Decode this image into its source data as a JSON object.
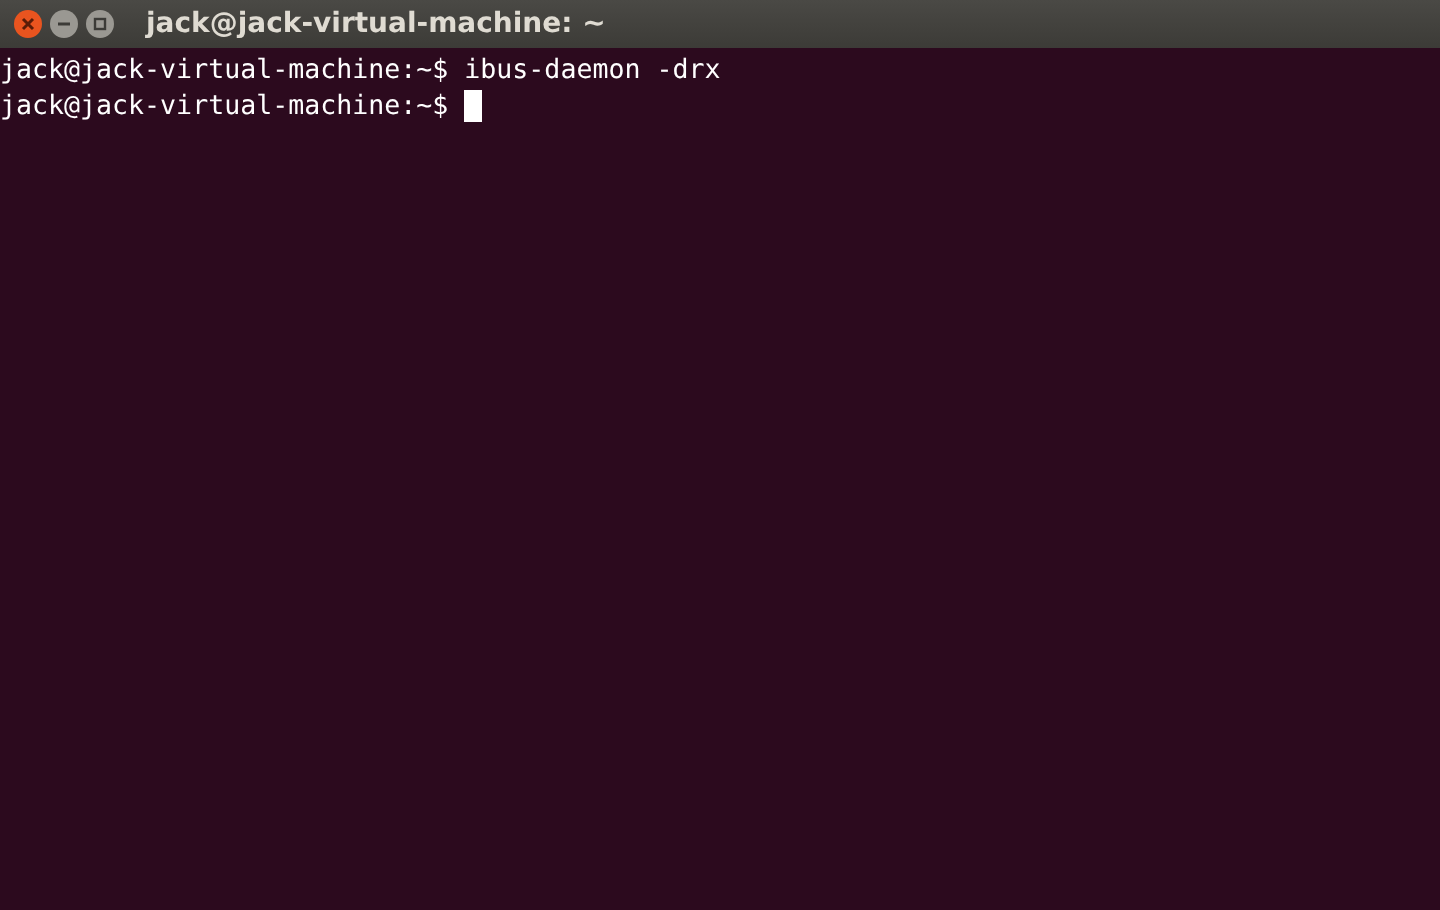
{
  "window": {
    "title": "jack@jack-virtual-machine: ~"
  },
  "terminal": {
    "lines": [
      {
        "text": "jack@jack-virtual-machine:~$ ibus-daemon -drx",
        "cursor": false
      },
      {
        "text": "jack@jack-virtual-machine:~$ ",
        "cursor": true
      }
    ]
  }
}
